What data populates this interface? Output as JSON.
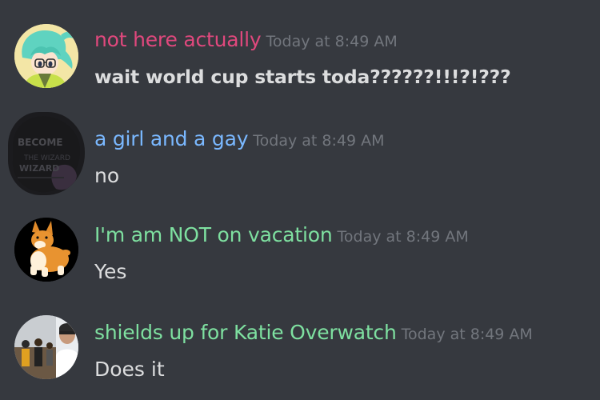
{
  "messages": [
    {
      "author": "not here actually",
      "author_color": "#e0487d",
      "timestamp": "Today at 8:49 AM",
      "text": "wait world cup starts toda??????!!!?!???",
      "bold": true
    },
    {
      "author": "a girl and a gay",
      "author_color": "#7ab8ff",
      "timestamp": "Today at 8:49 AM",
      "text": "no",
      "bold": false
    },
    {
      "author": "I'm am NOT on vacation",
      "author_color": "#7ee0a0",
      "timestamp": "Today at 8:49 AM",
      "text": "Yes",
      "bold": false
    },
    {
      "author": "shields up for Katie Overwatch",
      "author_color": "#7ee0a0",
      "timestamp": "Today at 8:49 AM",
      "text": "Does it",
      "bold": false
    }
  ],
  "avatars": [
    {
      "icon": "anime-character-avatar-icon"
    },
    {
      "icon": "redacted-avatar-icon",
      "text": "BECOME THE WIZARD WE"
    },
    {
      "icon": "corgi-avatar-icon"
    },
    {
      "icon": "photo-collage-avatar-icon"
    }
  ]
}
